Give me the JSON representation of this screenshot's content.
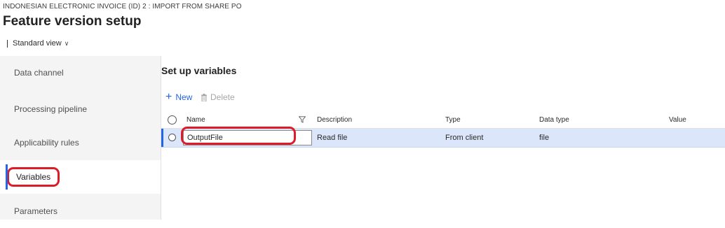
{
  "header": {
    "breadcrumb": "INDONESIAN ELECTRONIC INVOICE (ID) 2 : IMPORT FROM SHARE PO",
    "title": "Feature version setup",
    "view_label": "Standard view"
  },
  "nav": {
    "items": [
      {
        "label": "Data channel",
        "active": false
      },
      {
        "label": "Processing pipeline",
        "active": false
      },
      {
        "label": "Applicability rules",
        "active": false
      },
      {
        "label": "Variables",
        "active": true
      },
      {
        "label": "Parameters",
        "active": false
      }
    ]
  },
  "main": {
    "section_title": "Set up variables",
    "actions": {
      "new_label": "New",
      "delete_label": "Delete"
    },
    "grid": {
      "columns": [
        "Name",
        "Description",
        "Type",
        "Data type",
        "Value"
      ],
      "rows": [
        {
          "name": "OutputFile",
          "description": "Read file",
          "type": "From client",
          "data_type": "file",
          "value": "",
          "selected": true
        }
      ]
    }
  },
  "colors": {
    "accent": "#2266e3",
    "highlight_outline": "#dd1c2a",
    "selected_row": "#dbe6fa"
  }
}
